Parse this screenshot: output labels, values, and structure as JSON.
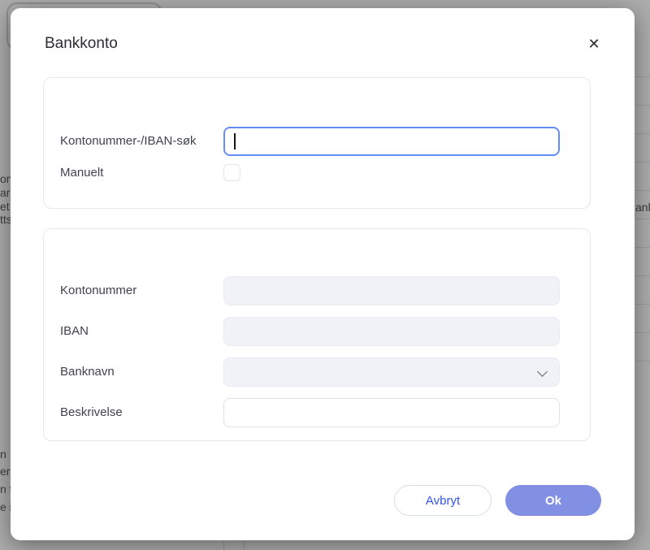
{
  "modal": {
    "title": "Bankkonto",
    "close_icon": "✕",
    "search_card": {
      "search_field": {
        "label": "Kontonummer-/IBAN-søk",
        "value": "",
        "placeholder": "",
        "focused": true
      },
      "manual_field": {
        "label": "Manuelt",
        "checked": false
      }
    },
    "details_card": {
      "fields": [
        {
          "label": "Kontonummer",
          "value": "",
          "type": "text",
          "disabled": true
        },
        {
          "label": "IBAN",
          "value": "",
          "type": "text",
          "disabled": true
        },
        {
          "label": "Banknavn",
          "value": "",
          "type": "select",
          "disabled": true
        },
        {
          "label": "Beskrivelse",
          "value": "",
          "type": "text",
          "disabled": false
        }
      ]
    },
    "footer": {
      "cancel_label": "Avbryt",
      "ok_label": "Ok"
    }
  },
  "backdrop": {
    "left_text_fragments": [
      "om",
      "ar",
      "et.",
      "tts",
      "n",
      "er",
      "n f",
      "e i"
    ],
    "right_text_fragment": "anl"
  },
  "colors": {
    "focus_border": "#648CF5",
    "ok_button_bg": "#8290E4",
    "cancel_button_text": "#3355E5",
    "disabled_field_bg": "#F0F2F8",
    "overlay_gray": "#ADADAD"
  }
}
